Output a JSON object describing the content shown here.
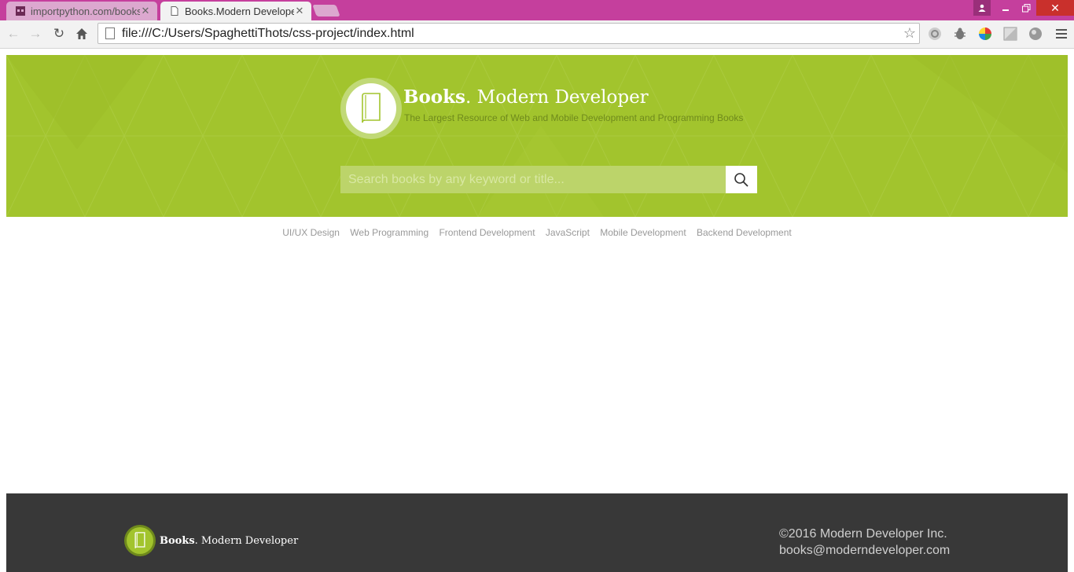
{
  "browser": {
    "tabs": [
      {
        "title": "importpython.com/books",
        "active": false
      },
      {
        "title": "Books.Modern Developer",
        "active": true
      }
    ],
    "url": "file:///C:/Users/SpaghettiThots/css-project/index.html"
  },
  "header": {
    "brand_bold": "Books",
    "brand_rest": ". Modern Developer",
    "tagline": "The Largest Resource of Web and Mobile Development and Programming Books",
    "search_placeholder": "Search books by any keyword or title..."
  },
  "nav": {
    "items": [
      "UI/UX Design",
      "Web Programming",
      "Frontend Development",
      "JavaScript",
      "Mobile Development",
      "Backend Development"
    ]
  },
  "footer": {
    "brand_bold": "Books",
    "brand_rest": ". Modern Developer",
    "copyright": "©2016 Modern Developer Inc.",
    "email": "books@moderndeveloper.com"
  },
  "colors": {
    "browser_frame": "#c53f9d",
    "hero": "#a2c42d",
    "footer": "#383838"
  }
}
